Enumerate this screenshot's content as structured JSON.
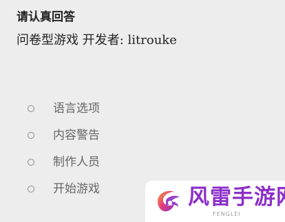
{
  "header": {
    "title": "请认真回答",
    "subtitle": "问卷型游戏 开发者: litrouke"
  },
  "options": [
    {
      "label": "语言选项",
      "selected": false
    },
    {
      "label": "内容警告",
      "selected": false
    },
    {
      "label": "制作人员",
      "selected": false
    },
    {
      "label": "开始游戏",
      "selected": false
    }
  ],
  "watermark": {
    "brand": "风雷手游网",
    "sub": "FENGLEI",
    "icon": "fenglei-logo",
    "colors": {
      "primary": "#8c2fc8",
      "accent": "#e43f7a"
    }
  },
  "colors": {
    "background": "#ededed",
    "text": "#222222",
    "option_text": "#666666"
  }
}
